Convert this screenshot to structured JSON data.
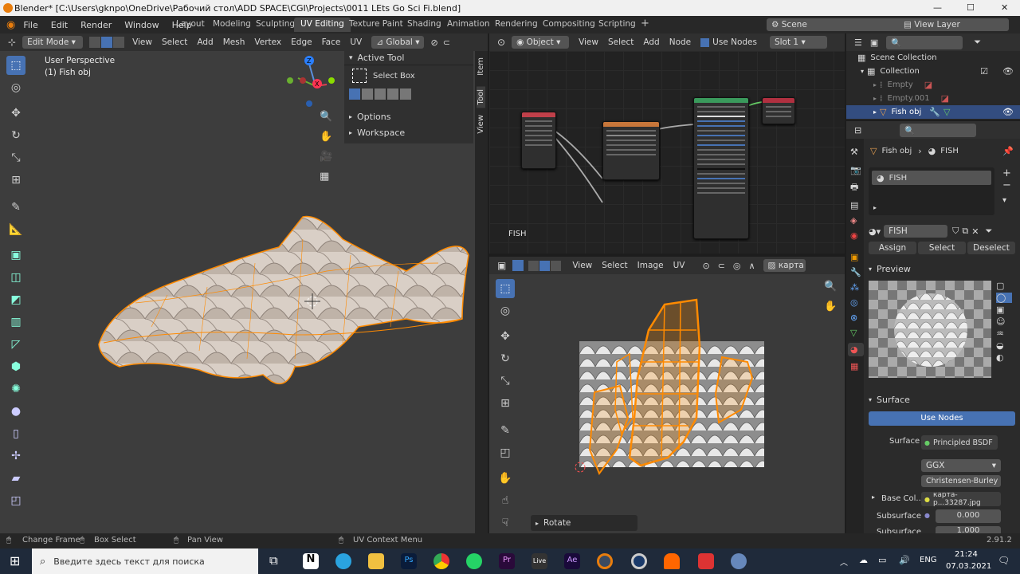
{
  "window": {
    "title": "Blender* [C:\\Users\\gknpo\\OneDrive\\Рабочий стол\\ADD SPACE\\CGI\\Projects\\0011 LEts Go Sci Fi.blend]"
  },
  "menu": [
    "File",
    "Edit",
    "Render",
    "Window",
    "Help"
  ],
  "workspaces": [
    "Layout",
    "Modeling",
    "Sculpting",
    "UV Editing",
    "Texture Paint",
    "Shading",
    "Animation",
    "Rendering",
    "Compositing",
    "Scripting"
  ],
  "active_workspace": "UV Editing",
  "scene": "Scene",
  "view_layer": "View Layer",
  "viewport": {
    "mode": "Edit Mode",
    "menus": [
      "View",
      "Select",
      "Add",
      "Mesh",
      "Vertex",
      "Edge",
      "Face",
      "UV"
    ],
    "orientation": "Global",
    "perspective": "User Perspective",
    "object": "(1) Fish obj"
  },
  "npanel": {
    "active_tool": "Active Tool",
    "select_box": "Select Box",
    "options": "Options",
    "workspace": "Workspace",
    "tabs": [
      "Item",
      "Tool",
      "View"
    ]
  },
  "node_editor": {
    "type": "Object",
    "menus": [
      "View",
      "Select",
      "Add",
      "Node"
    ],
    "use_nodes": "Use Nodes",
    "slot": "Slot 1",
    "material_label": "FISH"
  },
  "uv_editor": {
    "menus": [
      "View",
      "Select",
      "Image",
      "UV"
    ],
    "image": "карта",
    "rotate": "Rotate"
  },
  "outliner": {
    "root": "Scene Collection",
    "items": [
      {
        "name": "Collection"
      },
      {
        "name": "Empty"
      },
      {
        "name": "Empty.001"
      },
      {
        "name": "Fish obj"
      }
    ]
  },
  "properties": {
    "object": "Fish obj",
    "material": "FISH",
    "slot_item": "FISH",
    "mat_field": "FISH",
    "assign": "Assign",
    "select": "Select",
    "deselect": "Deselect",
    "preview": "Preview",
    "surface_header": "Surface",
    "use_nodes": "Use Nodes",
    "surface_label": "Surface",
    "surface_value": "Principled BSDF",
    "distribution": "GGX",
    "subsurface_method": "Christensen-Burley",
    "base_color_label": "Base Col...",
    "base_color_value": "карта-р...33287.jpg",
    "subsurface_label": "Subsurface",
    "subsurface_value": "0.000",
    "subsurface2_label": "Subsurface",
    "subsurface2_value": "1.000"
  },
  "status": {
    "change_frame": "Change Frame",
    "box_select": "Box Select",
    "pan_view": "Pan View",
    "uv_context": "UV Context Menu",
    "version": "2.91.2"
  },
  "taskbar": {
    "search": "Введите здесь текст для поиска",
    "lang": "ENG",
    "time": "21:24",
    "date": "07.03.2021"
  },
  "colors": {
    "accent": "#4772b3",
    "orange": "#ff8a00",
    "bg": "#1d1d1d",
    "panel": "#303030"
  }
}
